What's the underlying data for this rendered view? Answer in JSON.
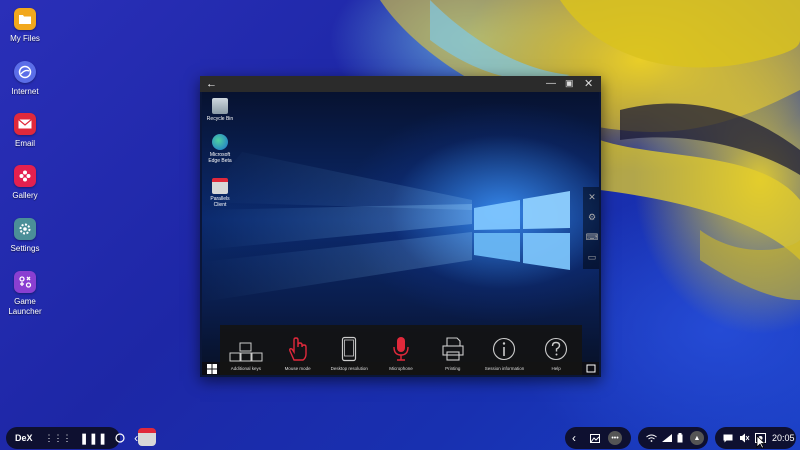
{
  "desktop": {
    "icons": [
      {
        "label": "My Files"
      },
      {
        "label": "Internet"
      },
      {
        "label": "Email"
      },
      {
        "label": "Gallery"
      },
      {
        "label": "Settings"
      },
      {
        "label": "Game Launcher"
      }
    ]
  },
  "window": {
    "remote_desktop": {
      "icons": [
        {
          "label": "Recycle Bin"
        },
        {
          "label": "Microsoft Edge Beta"
        },
        {
          "label": "Parallels Client"
        }
      ]
    },
    "toolbar": [
      {
        "label": "Additional keys",
        "icon": "keys-icon"
      },
      {
        "label": "Mouse mode",
        "icon": "hand-icon"
      },
      {
        "label": "Desktop resolution",
        "icon": "phone-icon"
      },
      {
        "label": "Microphone",
        "icon": "microphone-icon"
      },
      {
        "label": "Printing",
        "icon": "printer-icon"
      },
      {
        "label": "Session information",
        "icon": "info-icon"
      },
      {
        "label": "Help",
        "icon": "help-icon"
      }
    ],
    "side_toolbar": [
      "close-icon",
      "gear-icon",
      "keyboard-icon",
      "window-icon"
    ]
  },
  "taskbar": {
    "dex_label": "DeX",
    "clock": "20:05"
  },
  "colors": {
    "accent_red": "#e0293b",
    "taskbar": "#0e1030"
  }
}
